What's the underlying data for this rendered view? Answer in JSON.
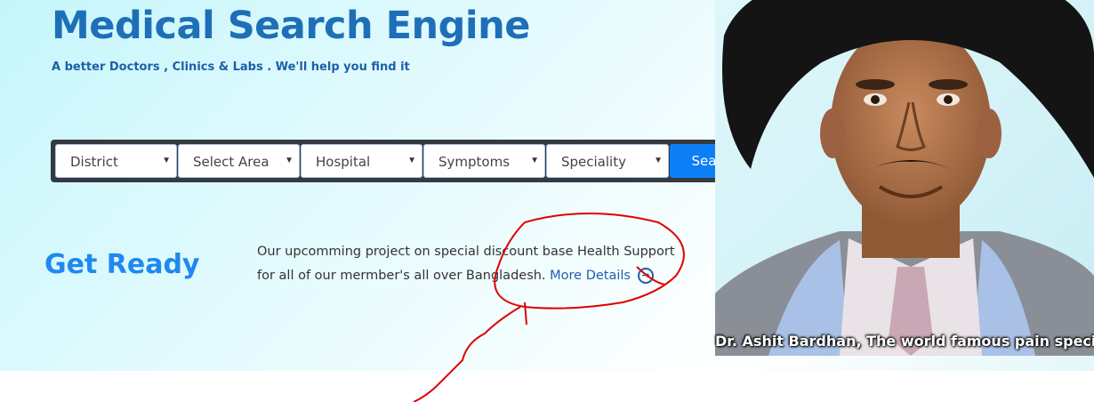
{
  "header": {
    "title": "Medical Search Engine",
    "subtitle": "A better Doctors , Clinics & Labs . We'll help you find it"
  },
  "search": {
    "selects": [
      {
        "label": "District"
      },
      {
        "label": "Select Area"
      },
      {
        "label": "Hospital"
      },
      {
        "label": "Symptoms"
      },
      {
        "label": "Speciality"
      }
    ],
    "button_label": "Search Now"
  },
  "promo": {
    "heading": "Get Ready",
    "line1": "Our upcomming project on special discount base Health Support",
    "line2": "for all of our mermber's all over Bangladesh.",
    "link_text": "More Details",
    "link_icon": "→"
  },
  "banner": {
    "caption": "Dr. Ashit Bardhan, The world famous pain specia"
  },
  "colors": {
    "brand": "#1f6fb8",
    "accent_button": "#0d7ff6",
    "search_bar_bg": "#343a40",
    "annotation": "#e00000"
  }
}
